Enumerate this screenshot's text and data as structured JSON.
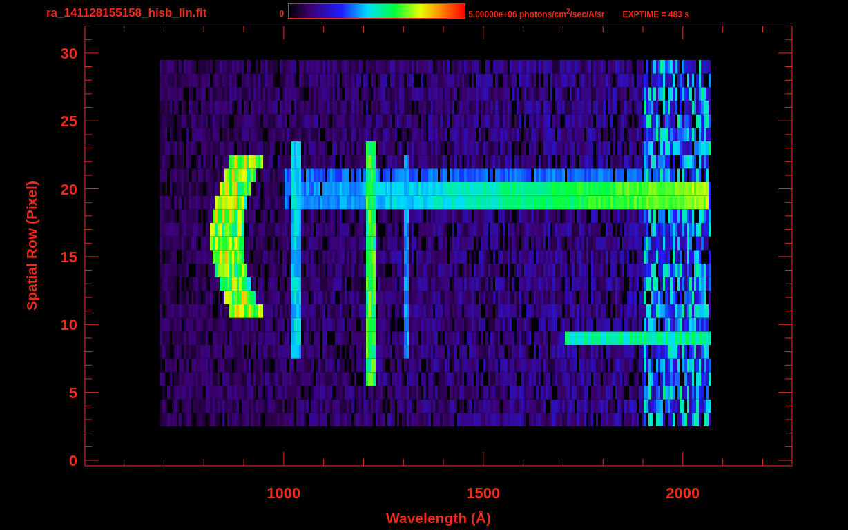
{
  "title": "ra_141128155158_hisb_lin.fit",
  "colorbar": {
    "min_label": "0",
    "max_label": "5.00000e+06 photons/cm$^{2}$/sec/A/sr"
  },
  "exposure": "EXPTIME = 483 s",
  "y_axis": {
    "label": "Spatial Row (Pixel)",
    "ticks": [
      "30",
      "25",
      "20",
      "15",
      "10",
      "5",
      "0"
    ]
  },
  "x_axis": {
    "label": "Wavelength (Å)",
    "ticks": [
      "1000",
      "1500",
      "2000"
    ]
  }
}
